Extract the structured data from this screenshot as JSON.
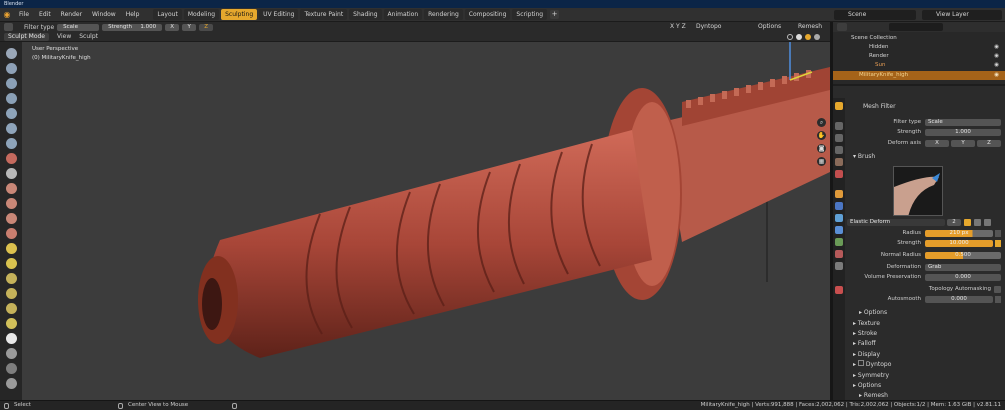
{
  "app": {
    "title": "Blender"
  },
  "menu": [
    "File",
    "Edit",
    "Render",
    "Window",
    "Help"
  ],
  "workspaces": [
    "Layout",
    "Modeling",
    "Sculpting",
    "UV Editing",
    "Texture Paint",
    "Shading",
    "Animation",
    "Rendering",
    "Compositing",
    "Scripting"
  ],
  "active_workspace": "Sculpting",
  "scene": {
    "name": "Scene",
    "view_layer": "View Layer"
  },
  "tool_header": {
    "filter_type_label": "Filter type",
    "filter_type_value": "Scale",
    "strength_label": "Strength",
    "strength_value": "1.000",
    "axes": [
      "X",
      "Y",
      "Z"
    ],
    "right_axes": "X Y Z",
    "dyntopo": "Dyntopo",
    "options": "Options",
    "remesh": "Remesh"
  },
  "mode_header": {
    "mode": "Sculpt Mode",
    "view": "View",
    "sculpt": "Sculpt"
  },
  "viewport": {
    "perspective": "User Perspective",
    "object": "(0) MilitaryKnife_high"
  },
  "outliner": {
    "items": [
      {
        "label": "Scene Collection"
      },
      {
        "label": "Hidden"
      },
      {
        "label": "Render"
      },
      {
        "label": "Sun"
      },
      {
        "label": "MilitaryKnife_high"
      }
    ]
  },
  "properties": {
    "mesh_filter_title": "Mesh Filter",
    "filter_type_label": "Filter type",
    "filter_type_value": "Scale",
    "strength_label": "Strength",
    "strength_value": "1.000",
    "deform_axis_label": "Deform axis",
    "deform_axes": [
      "X",
      "Y",
      "Z"
    ],
    "brush_section": "Brush",
    "brush_name": "Elastic Deform",
    "brush_users": "2",
    "radius_label": "Radius",
    "radius_value": "210 px",
    "brush_strength_label": "Strength",
    "brush_strength_value": "10.000",
    "normal_radius_label": "Normal Radius",
    "normal_radius_value": "0.500",
    "deformation_label": "Deformation",
    "deformation_value": "Grab",
    "volume_preservation_label": "Volume Preservation",
    "volume_preservation_value": "0.000",
    "topology_automasking": "Topology Automasking",
    "autosmooth_label": "Autosmooth",
    "autosmooth_value": "0.000",
    "options_sub": "Options",
    "sections": [
      "Texture",
      "Stroke",
      "Falloff",
      "Display",
      "Dyntopo",
      "Symmetry",
      "Options",
      "Remesh"
    ]
  },
  "status": {
    "select": "Select",
    "center_view": "Center View to Mouse",
    "stats": "MilitaryKnife_high | Verts:991,888 | Faces:2,002,062 | Tris:2,002,062 | Objects:1/2 | Mem: 1.63 GiB | v2.81.11"
  },
  "colors": {
    "accent": "#e6a82d",
    "knife": "#b04e3f",
    "viewport_bg": "#3c3c3c",
    "selection": "#a56319"
  },
  "icons": [
    "blender-logo-icon",
    "eye-icon",
    "brush-icon",
    "expand-icon",
    "magnify-icon",
    "hand-icon",
    "camera-icon",
    "grid-icon"
  ]
}
